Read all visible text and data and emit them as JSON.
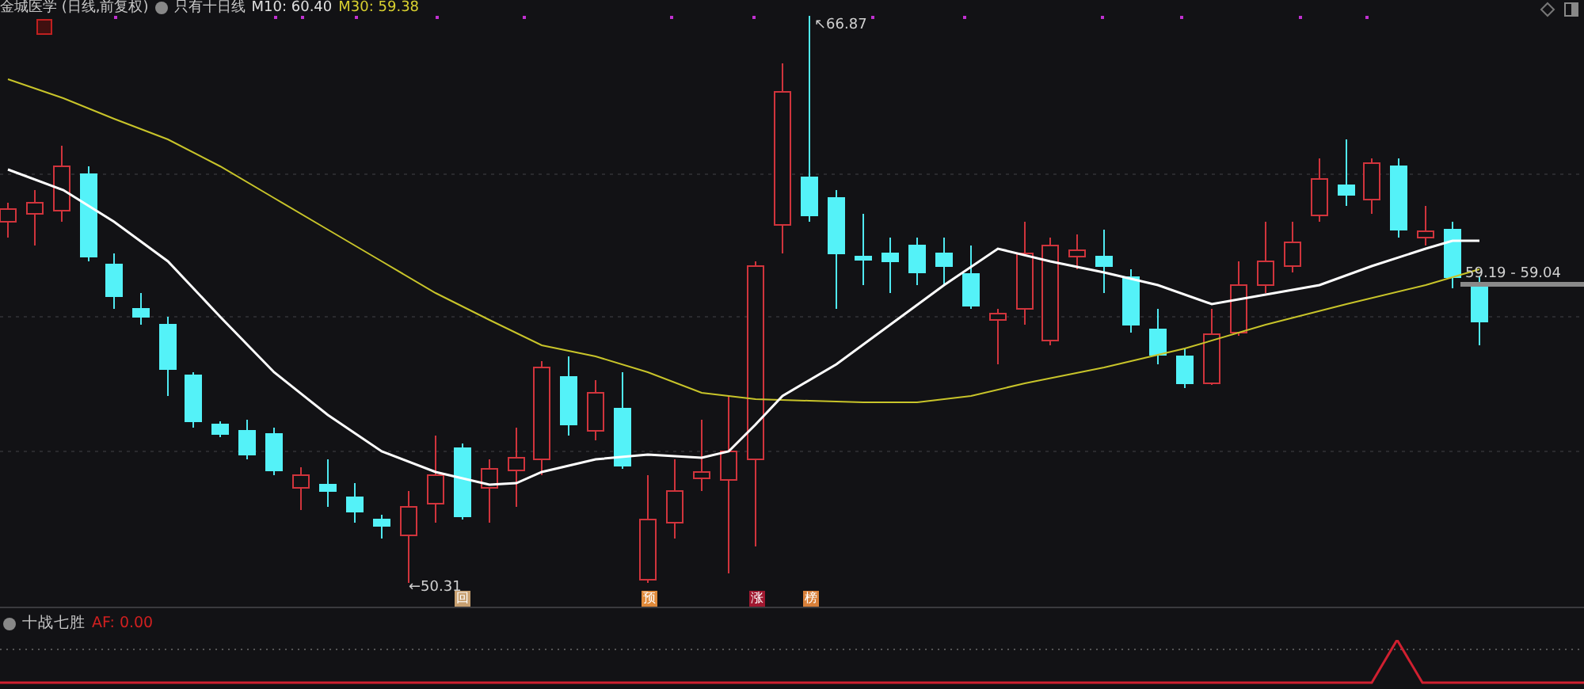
{
  "header": {
    "title": "金城医学 (日线,前复权)",
    "indicator": "只有十日线",
    "m10": "M10: 60.40",
    "m30": "M30: 59.38"
  },
  "high_label": "↖66.87",
  "low_label": "←50.31",
  "price_range": "59.19 - 59.04",
  "markers": [
    {
      "label": "回",
      "color": "#c8a070"
    },
    {
      "label": "预",
      "color": "#e08a3a"
    },
    {
      "label": "涨",
      "color": "#a01830"
    },
    {
      "label": "榜",
      "color": "#d8803a"
    }
  ],
  "sub_panel": {
    "title": "十战七胜",
    "value": "AF: 0.00"
  }
}
